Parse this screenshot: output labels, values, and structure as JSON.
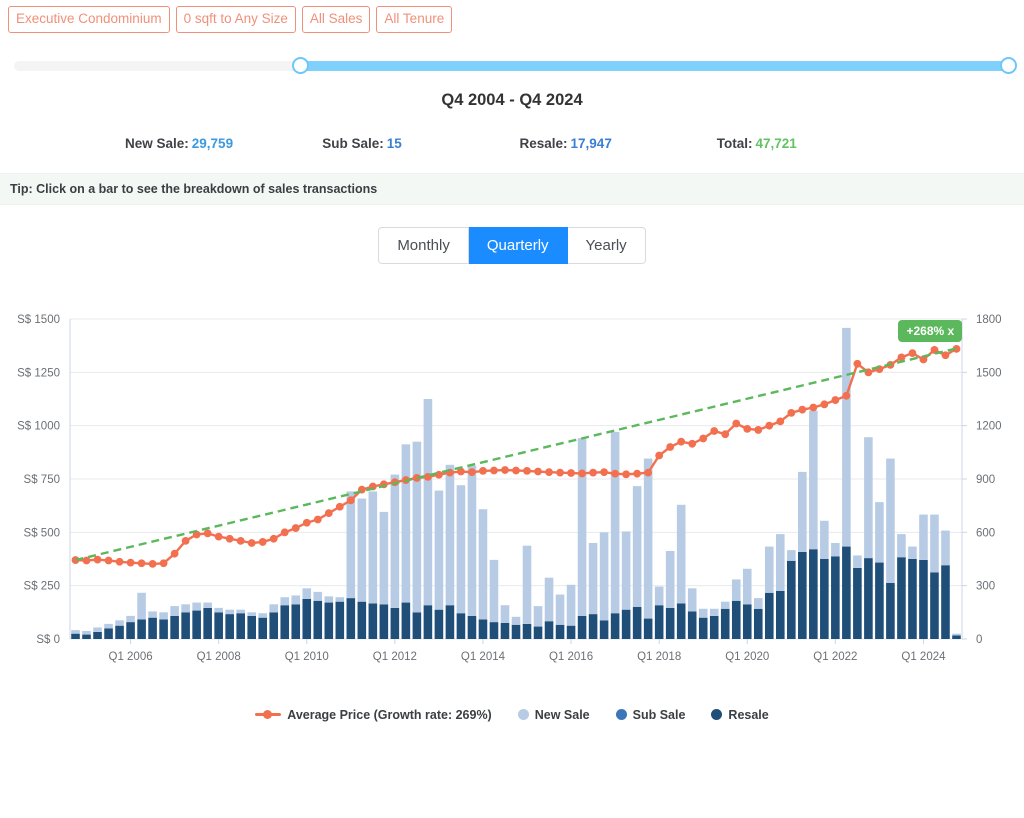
{
  "filters": [
    {
      "label": "Executive Condominium",
      "name": "property-type"
    },
    {
      "label": "0 sqft to Any Size",
      "name": "size-range"
    },
    {
      "label": "All Sales",
      "name": "sale-type"
    },
    {
      "label": "All Tenure",
      "name": "tenure"
    }
  ],
  "slider": {
    "left_handle_pct": 28.8,
    "right_handle_pct": 99.85
  },
  "range_title": "Q4 2004 - Q4 2024",
  "stats": [
    {
      "label": "New Sale:",
      "value": "29,759",
      "color": "#3a9ae0"
    },
    {
      "label": "Sub Sale:",
      "value": "15",
      "color": "#3a7fd5"
    },
    {
      "label": "Resale:",
      "value": "17,947",
      "color": "#3a7fd5"
    },
    {
      "label": "Total:",
      "value": "47,721",
      "color": "#63c363"
    }
  ],
  "tip": "Tip: Click on a bar to see the breakdown of sales transactions",
  "period_tabs": [
    {
      "label": "Monthly",
      "active": false
    },
    {
      "label": "Quarterly",
      "active": true
    },
    {
      "label": "Yearly",
      "active": false
    }
  ],
  "growth_badge": "+268% x",
  "colors": {
    "new_sale": "#b7cce4",
    "sub_sale": "#3a76b8",
    "resale": "#1f4e79",
    "price_line": "#f2704f",
    "trend_line": "#5cb85c",
    "accent": "#1a8cff",
    "chip_border": "#f0907a"
  },
  "chart_data": {
    "type": "bar",
    "title": "",
    "xlabel": "",
    "ylabel": "S$",
    "y2label": "",
    "ylim": [
      0,
      1500
    ],
    "y2lim": [
      0,
      1800
    ],
    "yticks": [
      "S$ 0",
      "S$ 250",
      "S$ 500",
      "S$ 750",
      "S$ 1000",
      "S$ 1250",
      "S$ 1500"
    ],
    "ytick_values": [
      0,
      250,
      500,
      750,
      1000,
      1250,
      1500
    ],
    "y2ticks": [
      "0",
      "300",
      "600",
      "900",
      "1200",
      "1500",
      "1800"
    ],
    "y2tick_values": [
      0,
      300,
      600,
      900,
      1200,
      1500,
      1800
    ],
    "grid": true,
    "legend_position": "bottom",
    "xtick_labels": [
      "Q1 2006",
      "Q1 2008",
      "Q1 2010",
      "Q1 2012",
      "Q1 2014",
      "Q1 2016",
      "Q1 2018",
      "Q1 2020",
      "Q1 2022",
      "Q1 2024"
    ],
    "xtick_indices": [
      5,
      13,
      21,
      29,
      37,
      45,
      53,
      61,
      69,
      77
    ],
    "categories": [
      "Q4 2004",
      "Q1 2005",
      "Q2 2005",
      "Q3 2005",
      "Q4 2005",
      "Q1 2006",
      "Q2 2006",
      "Q3 2006",
      "Q4 2006",
      "Q1 2007",
      "Q2 2007",
      "Q3 2007",
      "Q4 2007",
      "Q1 2008",
      "Q2 2008",
      "Q3 2008",
      "Q4 2008",
      "Q1 2009",
      "Q2 2009",
      "Q3 2009",
      "Q4 2009",
      "Q1 2010",
      "Q2 2010",
      "Q3 2010",
      "Q4 2010",
      "Q1 2011",
      "Q2 2011",
      "Q3 2011",
      "Q4 2011",
      "Q1 2012",
      "Q2 2012",
      "Q3 2012",
      "Q4 2012",
      "Q1 2013",
      "Q2 2013",
      "Q3 2013",
      "Q4 2013",
      "Q1 2014",
      "Q2 2014",
      "Q3 2014",
      "Q4 2014",
      "Q1 2015",
      "Q2 2015",
      "Q3 2015",
      "Q4 2015",
      "Q1 2016",
      "Q2 2016",
      "Q3 2016",
      "Q4 2016",
      "Q1 2017",
      "Q2 2017",
      "Q3 2017",
      "Q4 2017",
      "Q1 2018",
      "Q2 2018",
      "Q3 2018",
      "Q4 2018",
      "Q1 2019",
      "Q2 2019",
      "Q3 2019",
      "Q4 2019",
      "Q1 2020",
      "Q2 2020",
      "Q3 2020",
      "Q4 2020",
      "Q1 2021",
      "Q2 2021",
      "Q3 2021",
      "Q4 2021",
      "Q1 2022",
      "Q2 2022",
      "Q3 2022",
      "Q4 2022",
      "Q1 2023",
      "Q2 2023",
      "Q3 2023",
      "Q4 2023",
      "Q1 2024",
      "Q2 2024",
      "Q3 2024",
      "Q4 2024"
    ],
    "series": [
      {
        "name": "Resale",
        "type": "bar",
        "stack": "vol",
        "axis": "y2",
        "color": "#1f4e79",
        "values": [
          30,
          25,
          40,
          60,
          75,
          95,
          110,
          120,
          110,
          130,
          150,
          160,
          175,
          150,
          140,
          145,
          130,
          120,
          150,
          190,
          195,
          225,
          215,
          205,
          210,
          230,
          210,
          200,
          195,
          175,
          205,
          150,
          190,
          165,
          190,
          145,
          130,
          110,
          95,
          90,
          80,
          85,
          70,
          100,
          80,
          75,
          130,
          140,
          105,
          145,
          165,
          180,
          115,
          190,
          175,
          200,
          155,
          120,
          130,
          170,
          215,
          195,
          170,
          260,
          270,
          440,
          490,
          505,
          450,
          465,
          520,
          400,
          455,
          430,
          315,
          460,
          450,
          445,
          375,
          415,
          20
        ]
      },
      {
        "name": "Sub Sale",
        "type": "bar",
        "stack": "vol",
        "axis": "y2",
        "color": "#3a76b8",
        "values": [
          0,
          0,
          0,
          0,
          0,
          0,
          0,
          0,
          0,
          0,
          0,
          0,
          0,
          0,
          0,
          0,
          0,
          0,
          0,
          0,
          0,
          0,
          0,
          0,
          0,
          0,
          0,
          0,
          0,
          0,
          0,
          0,
          0,
          0,
          0,
          0,
          0,
          0,
          0,
          0,
          0,
          0,
          0,
          0,
          0,
          0,
          0,
          0,
          0,
          0,
          0,
          0,
          0,
          0,
          0,
          0,
          0,
          0,
          0,
          0,
          0,
          0,
          0,
          0,
          0,
          0,
          0,
          0,
          0,
          0,
          0,
          0,
          0,
          0,
          0,
          0,
          0,
          0,
          0,
          0,
          0
        ]
      },
      {
        "name": "New Sale",
        "type": "bar",
        "stack": "vol",
        "axis": "y2",
        "color": "#b7cce4",
        "values": [
          20,
          20,
          25,
          25,
          30,
          35,
          150,
          35,
          40,
          55,
          45,
          45,
          30,
          25,
          25,
          20,
          20,
          25,
          45,
          45,
          50,
          60,
          50,
          35,
          25,
          600,
          580,
          630,
          520,
          750,
          890,
          960,
          1160,
          670,
          790,
          720,
          845,
          620,
          350,
          100,
          45,
          440,
          115,
          245,
          170,
          230,
          1000,
          400,
          495,
          1020,
          440,
          680,
          900,
          105,
          320,
          555,
          130,
          50,
          40,
          40,
          120,
          200,
          60,
          260,
          320,
          60,
          450,
          780,
          215,
          75,
          1230,
          70,
          680,
          340,
          700,
          130,
          70,
          255,
          325,
          195,
          10
        ]
      },
      {
        "name": "Average Price (Growth rate: 269%)",
        "type": "line",
        "axis": "y",
        "color": "#f2704f",
        "values": [
          370,
          368,
          372,
          368,
          362,
          358,
          355,
          352,
          355,
          400,
          460,
          490,
          495,
          480,
          470,
          460,
          450,
          455,
          470,
          500,
          520,
          545,
          560,
          590,
          620,
          650,
          700,
          715,
          725,
          735,
          745,
          755,
          760,
          770,
          780,
          785,
          782,
          788,
          790,
          792,
          790,
          788,
          785,
          782,
          780,
          778,
          776,
          780,
          782,
          775,
          772,
          775,
          780,
          860,
          900,
          925,
          915,
          940,
          975,
          960,
          1010,
          985,
          980,
          1000,
          1020,
          1060,
          1075,
          1085,
          1100,
          1120,
          1140,
          1290,
          1250,
          1265,
          1285,
          1320,
          1340,
          1310,
          1355,
          1330,
          1360
        ]
      },
      {
        "name": "Growth trend",
        "type": "line",
        "style": "dashed",
        "axis": "y",
        "color": "#5cb85c",
        "values": [
          370,
          1362
        ]
      }
    ]
  }
}
